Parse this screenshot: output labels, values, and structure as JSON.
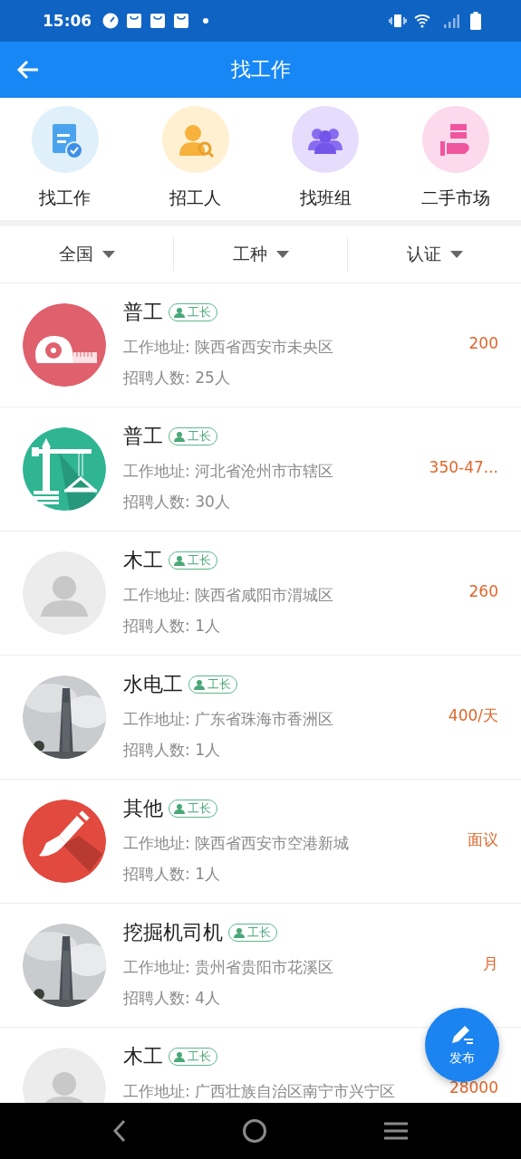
{
  "status_bar": {
    "time": "15:06"
  },
  "app_bar": {
    "title": "找工作"
  },
  "categories": [
    {
      "label": "找工作",
      "kind": "job"
    },
    {
      "label": "招工人",
      "kind": "hire"
    },
    {
      "label": "找班组",
      "kind": "team"
    },
    {
      "label": "二手市场",
      "kind": "market"
    }
  ],
  "filters": [
    {
      "label": "全国"
    },
    {
      "label": "工种"
    },
    {
      "label": "认证"
    }
  ],
  "jobs": [
    {
      "title": "普工",
      "badge": "工长",
      "address": "工作地址: 陕西省西安市未央区",
      "count": "招聘人数: 25人",
      "salary": "200",
      "kind": "tape"
    },
    {
      "title": "普工",
      "badge": "工长",
      "address": "工作地址: 河北省沧州市市辖区",
      "count": "招聘人数: 30人",
      "salary": "350-47...",
      "kind": "crane"
    },
    {
      "title": "木工",
      "badge": "工长",
      "address": "工作地址: 陕西省咸阳市渭城区",
      "count": "招聘人数: 1人",
      "salary": "260",
      "kind": "placeholder"
    },
    {
      "title": "水电工",
      "badge": "工长",
      "address": "工作地址: 广东省珠海市香洲区",
      "count": "招聘人数: 1人",
      "salary": "400/天",
      "kind": "picture"
    },
    {
      "title": "其他",
      "badge": "工长",
      "address": "工作地址: 陕西省西安市空港新城",
      "count": "招聘人数: 1人",
      "salary": "面议",
      "kind": "brush"
    },
    {
      "title": "挖掘机司机",
      "badge": "工长",
      "address": "工作地址: 贵州省贵阳市花溪区",
      "count": "招聘人数: 4人",
      "salary": "月",
      "kind": "picture"
    },
    {
      "title": "木工",
      "badge": "工长",
      "address": "工作地址: 广西壮族自治区南宁市兴宁区",
      "salary": "28000",
      "kind": "placeholder"
    }
  ],
  "fab": {
    "label": "发布"
  }
}
